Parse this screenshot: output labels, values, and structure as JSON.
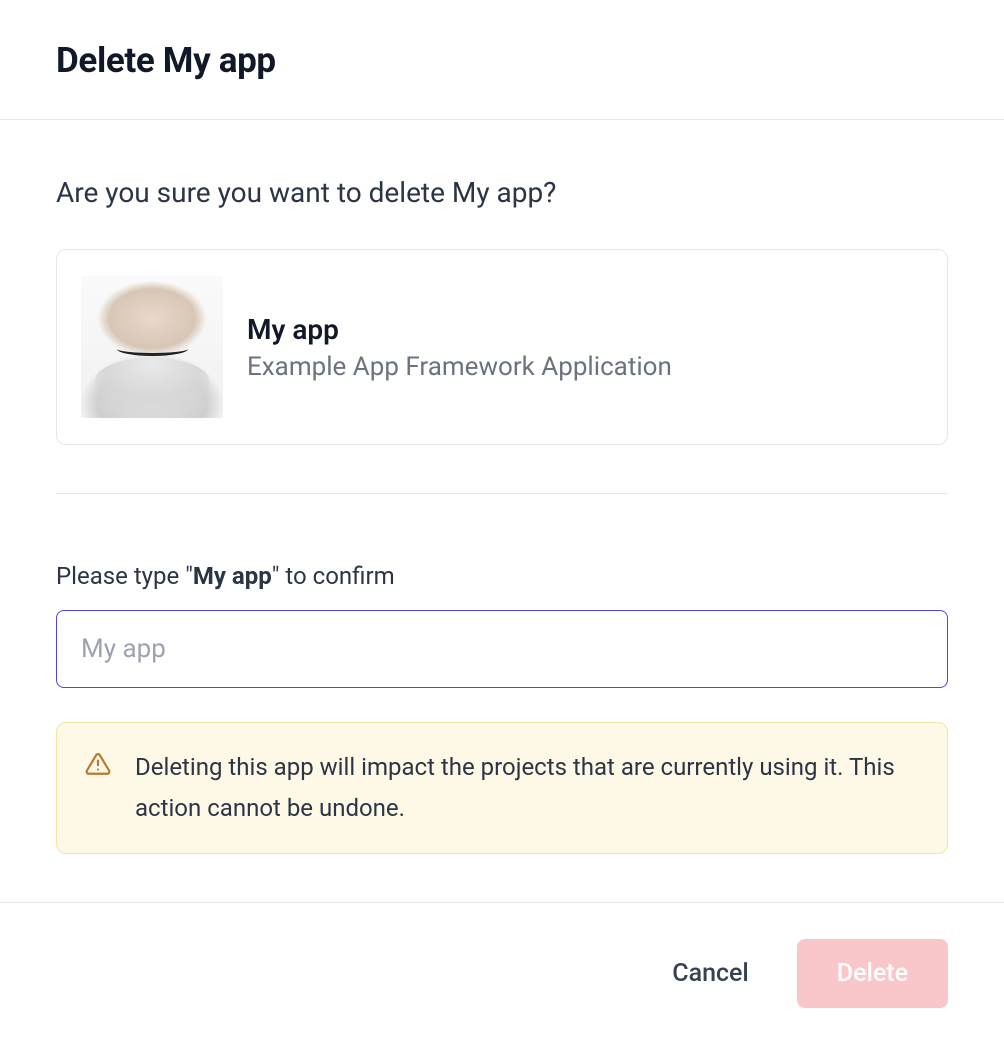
{
  "header": {
    "title": "Delete My app"
  },
  "main": {
    "confirm_question": "Are you sure you want to delete My app?",
    "app": {
      "name": "My app",
      "description": "Example App Framework Application"
    },
    "confirm_label_prefix": "Please type \"",
    "confirm_label_bold": "My app",
    "confirm_label_suffix": "\" to confirm",
    "input": {
      "placeholder": "My app",
      "value": ""
    },
    "warning": {
      "icon": "warning-triangle-icon",
      "text": "Deleting this app will impact the projects that are currently using it. This action cannot be undone."
    }
  },
  "footer": {
    "cancel_label": "Cancel",
    "delete_label": "Delete"
  },
  "colors": {
    "primary_border": "#4f46e5",
    "warning_bg": "#fef9e7",
    "warning_border": "#f2e4a8",
    "warning_icon": "#b8792d",
    "delete_bg": "#f9c6c9"
  }
}
